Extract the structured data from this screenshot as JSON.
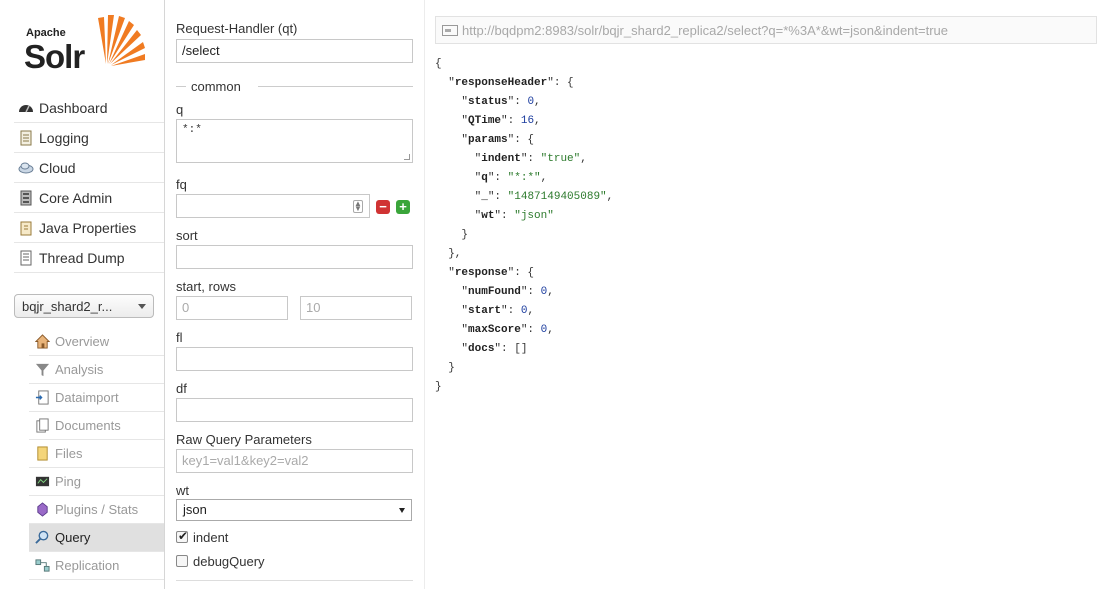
{
  "logo": {
    "apache": "Apache",
    "solr": "Solr"
  },
  "main_menu": [
    {
      "label": "Dashboard",
      "icon": "dashboard-icon"
    },
    {
      "label": "Logging",
      "icon": "logging-icon"
    },
    {
      "label": "Cloud",
      "icon": "cloud-icon"
    },
    {
      "label": "Core Admin",
      "icon": "core-admin-icon"
    },
    {
      "label": "Java Properties",
      "icon": "java-properties-icon"
    },
    {
      "label": "Thread Dump",
      "icon": "thread-dump-icon"
    }
  ],
  "core_selector": {
    "selected": "bqjr_shard2_r..."
  },
  "core_menu": [
    {
      "label": "Overview",
      "icon": "overview-icon"
    },
    {
      "label": "Analysis",
      "icon": "analysis-icon"
    },
    {
      "label": "Dataimport",
      "icon": "dataimport-icon"
    },
    {
      "label": "Documents",
      "icon": "documents-icon"
    },
    {
      "label": "Files",
      "icon": "files-icon"
    },
    {
      "label": "Ping",
      "icon": "ping-icon"
    },
    {
      "label": "Plugins / Stats",
      "icon": "plugins-icon"
    },
    {
      "label": "Query",
      "icon": "query-icon",
      "active": true
    },
    {
      "label": "Replication",
      "icon": "replication-icon"
    }
  ],
  "form": {
    "request_handler_label": "Request-Handler (qt)",
    "request_handler_value": "/select",
    "common_legend": "common",
    "q_label": "q",
    "q_value": "*:*",
    "fq_label": "fq",
    "fq_value": "",
    "sort_label": "sort",
    "sort_value": "",
    "start_rows_label": "start, rows",
    "start_placeholder": "0",
    "rows_placeholder": "10",
    "fl_label": "fl",
    "fl_value": "",
    "df_label": "df",
    "df_value": "",
    "raw_label": "Raw Query Parameters",
    "raw_placeholder": "key1=val1&key2=val2",
    "wt_label": "wt",
    "wt_value": "json",
    "indent_label": "indent",
    "indent_checked": true,
    "debug_label": "debugQuery",
    "debug_checked": false
  },
  "url": "http://bqdpm2:8983/solr/bqjr_shard2_replica2/select?q=*%3A*&wt=json&indent=true",
  "response_json": {
    "status": "0",
    "qtime": "16",
    "indent": "\"true\"",
    "q": "\"*:*\"",
    "underscore": "\"1487149405089\"",
    "wt": "\"json\"",
    "numFound": "0",
    "start": "0",
    "maxScore": "0",
    "docs": "[]"
  },
  "colors": {
    "active_menu_bg": "#e0e0e0",
    "json_string": "#2c7a2c",
    "json_number": "#1b3c9e",
    "minus_btn": "#d03333",
    "plus_btn": "#3aa53a",
    "logo_sun": "#f07b22"
  }
}
